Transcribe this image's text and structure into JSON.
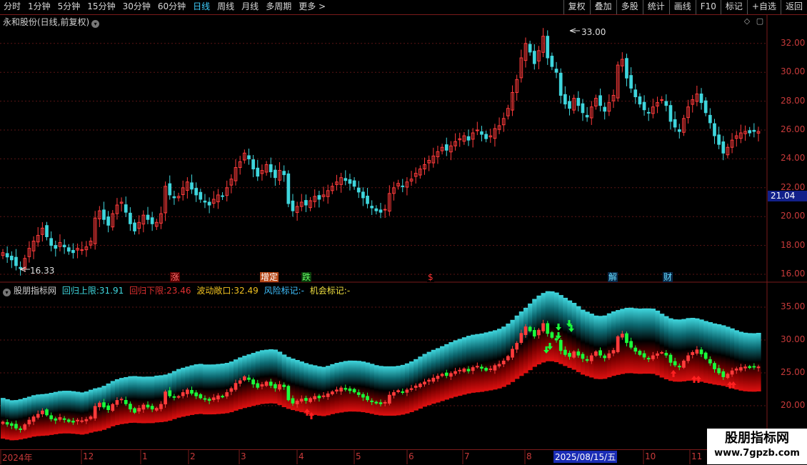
{
  "toolbar": {
    "periods": [
      "分时",
      "1分钟",
      "5分钟",
      "15分钟",
      "30分钟",
      "60分钟",
      "日线",
      "周线",
      "月线",
      "多周期",
      "更多 >"
    ],
    "active_period": "日线",
    "actions": [
      "复权",
      "叠加",
      "多股",
      "统计",
      "画线",
      "F10",
      "标记",
      "+自选",
      "返回"
    ]
  },
  "main_chart": {
    "title": "永和股份(日线,前复权)",
    "y_ticks": [
      "32.00",
      "30.00",
      "28.00",
      "26.00",
      "24.00",
      "22.00",
      "20.00",
      "18.00",
      "16.00"
    ],
    "high_label": "33.00",
    "low_label": "16.33",
    "current_price": "21.04",
    "events": [
      {
        "text": "涨",
        "color": "#ff6b6b",
        "bg": "#5a0000"
      },
      {
        "text": "增定",
        "color": "#ffffff",
        "bg": "#b84a1a"
      },
      {
        "text": "跌",
        "color": "#66ff66",
        "bg": "#0a3a0a"
      },
      {
        "text": "$",
        "color": "#ff3333",
        "bg": "#000000"
      },
      {
        "text": "解",
        "color": "#66ddff",
        "bg": "#0a2a4a"
      },
      {
        "text": "财",
        "color": "#66ddff",
        "bg": "#0a2a4a"
      }
    ]
  },
  "indicator": {
    "name": "股朋指标网",
    "upper_label": "回归上限:",
    "upper_value": "31.91",
    "lower_label": "回归下限:",
    "lower_value": "23.46",
    "wave_label": "波动敞口:",
    "wave_value": "32.49",
    "risk_label": "风险标记:",
    "risk_value": "-",
    "chance_label": "机会标记:",
    "chance_value": "-",
    "y_ticks": [
      "35.00",
      "30.00",
      "25.00",
      "20.00"
    ]
  },
  "date_axis": {
    "labels": [
      "2024年",
      "12",
      "1",
      "2",
      "3",
      "4",
      "5",
      "6",
      "7",
      "8",
      "10",
      "11"
    ],
    "selected": "2025/08/15/五"
  },
  "watermark": {
    "line1": "股朋指标网",
    "line2": "www.7gpzb.com"
  },
  "chart_data": {
    "type": "candlestick",
    "title": "永和股份(日线,前复权)",
    "ylim": [
      15.5,
      33.5
    ],
    "close_series": [
      17.5,
      17.2,
      17.0,
      16.6,
      16.4,
      17.1,
      17.8,
      18.3,
      18.7,
      19.2,
      18.6,
      18.0,
      17.8,
      18.2,
      17.9,
      17.6,
      17.5,
      17.8,
      17.7,
      17.9,
      18.3,
      19.9,
      20.4,
      19.8,
      19.4,
      20.2,
      20.8,
      21.0,
      20.3,
      19.5,
      19.0,
      19.6,
      20.1,
      19.8,
      19.5,
      19.6,
      20.2,
      22.1,
      21.5,
      21.3,
      21.4,
      22.0,
      22.4,
      21.9,
      21.5,
      21.2,
      21.0,
      20.8,
      21.2,
      21.5,
      21.4,
      22.0,
      22.6,
      23.4,
      23.8,
      24.4,
      24.0,
      23.3,
      22.8,
      23.2,
      23.6,
      23.1,
      22.7,
      23.2,
      22.9,
      20.9,
      20.4,
      20.7,
      21.0,
      20.8,
      21.1,
      21.4,
      21.2,
      21.5,
      21.8,
      22.1,
      22.4,
      22.7,
      22.5,
      22.3,
      22.1,
      21.7,
      21.3,
      20.9,
      20.6,
      20.4,
      20.3,
      20.5,
      21.6,
      22.0,
      22.3,
      22.1,
      22.4,
      22.6,
      23.0,
      23.3,
      23.6,
      23.9,
      24.2,
      24.5,
      24.8,
      24.6,
      24.9,
      25.2,
      25.4,
      25.6,
      25.3,
      25.8,
      26.0,
      25.7,
      25.4,
      25.6,
      26.1,
      26.3,
      26.8,
      27.5,
      28.6,
      29.5,
      31.0,
      32.0,
      31.4,
      30.6,
      31.5,
      32.5,
      31.0,
      30.4,
      30.0,
      28.4,
      27.8,
      27.5,
      28.2,
      27.7,
      27.2,
      26.9,
      27.6,
      28.2,
      27.7,
      27.3,
      27.9,
      28.4,
      30.5,
      30.9,
      29.6,
      28.9,
      28.3,
      27.8,
      27.4,
      27.2,
      27.6,
      27.9,
      28.1,
      27.7,
      26.6,
      26.2,
      25.9,
      26.8,
      27.6,
      28.1,
      28.5,
      27.9,
      27.2,
      26.5,
      25.6,
      25.0,
      24.4,
      24.8,
      25.3,
      25.6,
      25.8,
      25.9,
      25.8,
      25.9,
      25.9
    ]
  }
}
